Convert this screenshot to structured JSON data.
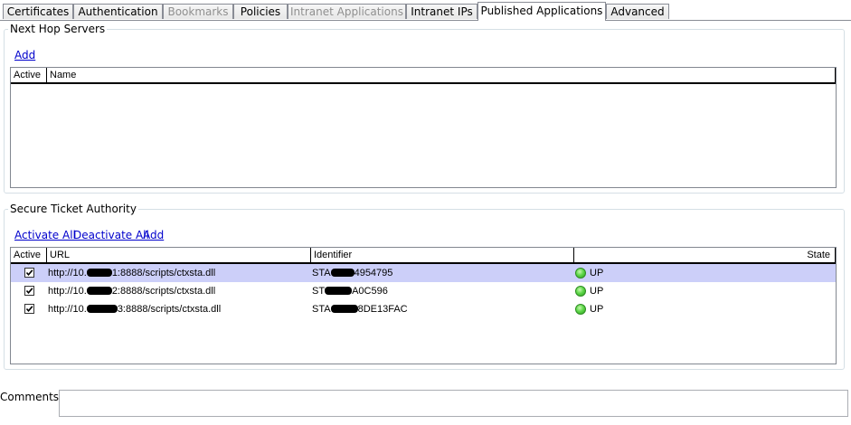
{
  "tabs": [
    {
      "label": "Certificates",
      "state": "normal"
    },
    {
      "label": "Authentication",
      "state": "normal"
    },
    {
      "label": "Bookmarks",
      "state": "disabled"
    },
    {
      "label": "Policies",
      "state": "normal"
    },
    {
      "label": "Intranet Applications",
      "state": "disabled"
    },
    {
      "label": "Intranet IPs",
      "state": "normal"
    },
    {
      "label": "Published Applications",
      "state": "active"
    },
    {
      "label": "Advanced",
      "state": "normal"
    }
  ],
  "next_hop": {
    "title": "Next Hop Servers",
    "add_label": "Add",
    "columns": [
      "Active",
      "Name"
    ],
    "rows": []
  },
  "sta": {
    "title": "Secure Ticket Authority",
    "activate_all_label": "Activate All",
    "deactivate_all_label": "Deactivate All",
    "add_label": "Add",
    "columns": [
      "Active",
      "URL",
      "Identifier",
      "State"
    ],
    "rows": [
      {
        "active": true,
        "url_prefix": "http://10.",
        "url_suffix": "1:8888/scripts/ctxsta.dll",
        "id_prefix": "STA",
        "id_suffix": "4954795",
        "state": "UP",
        "selected": true
      },
      {
        "active": true,
        "url_prefix": "http://10.",
        "url_suffix": "2:8888/scripts/ctxsta.dll",
        "id_prefix": "ST",
        "id_suffix": "A0C596",
        "state": "UP",
        "selected": false
      },
      {
        "active": true,
        "url_prefix": "http://10.",
        "url_suffix": "3:8888/scripts/ctxsta.dll",
        "id_prefix": "STA",
        "id_suffix": "8DE13FAC",
        "state": "UP",
        "selected": false
      }
    ]
  },
  "comments": {
    "label": "Comments",
    "value": ""
  },
  "colors": {
    "selected_row": "#cccff9",
    "status_up": "#5fd84a",
    "link": "#0000cc"
  },
  "icons": {
    "check": "checkbox-checked-icon",
    "status": "status-up-icon"
  }
}
